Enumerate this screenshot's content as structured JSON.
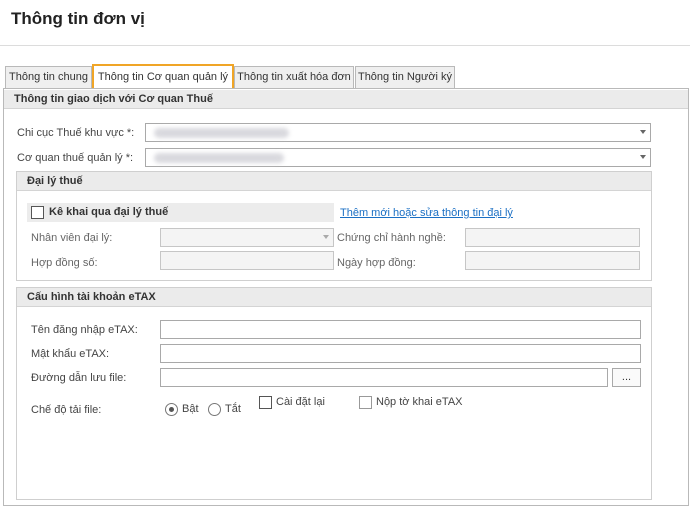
{
  "page": {
    "title": "Thông tin đơn vị"
  },
  "tabs": [
    {
      "label": "Thông tin chung"
    },
    {
      "label": "Thông tin Cơ quan quản lý"
    },
    {
      "label": "Thông tin xuất hóa đơn"
    },
    {
      "label": "Thông tin Người ký"
    }
  ],
  "active_tab": "Thông tin Cơ quan quản lý",
  "section_main": {
    "title": "Thông tin giao dịch với Cơ quan Thuế",
    "chi_cuc_label": "Chi cục Thuế khu vực *:",
    "co_quan_label": "Cơ quan thuế quản lý *:"
  },
  "agent_group": {
    "title": "Đại lý thuế",
    "checkbox_label": "Kê khai qua đại lý thuế",
    "link_label": "Thêm mới hoặc sửa thông tin đại lý",
    "staff_label": "Nhân viên đại lý:",
    "cert_label": "Chứng chỉ hành nghề:",
    "contract_no_label": "Hợp đồng số:",
    "contract_date_label": "Ngày hợp đồng:"
  },
  "etax_group": {
    "title": "Cấu hình tài khoản eTAX",
    "username_label": "Tên đăng nhập eTAX:",
    "password_label": "Mật khẩu eTAX:",
    "path_label": "Đường dẫn lưu file:",
    "browse_label": "...",
    "mode_label": "Chế độ tải file:",
    "mode_on_label": "Bật",
    "mode_off_label": "Tắt",
    "reinstall_label": "Cài đặt lại",
    "submit_label": "Nộp tờ khai eTAX"
  },
  "colors": {
    "active_tab_border": "#f0a526",
    "link": "#1a6fc4",
    "group_header_bg": "#ebebeb"
  }
}
